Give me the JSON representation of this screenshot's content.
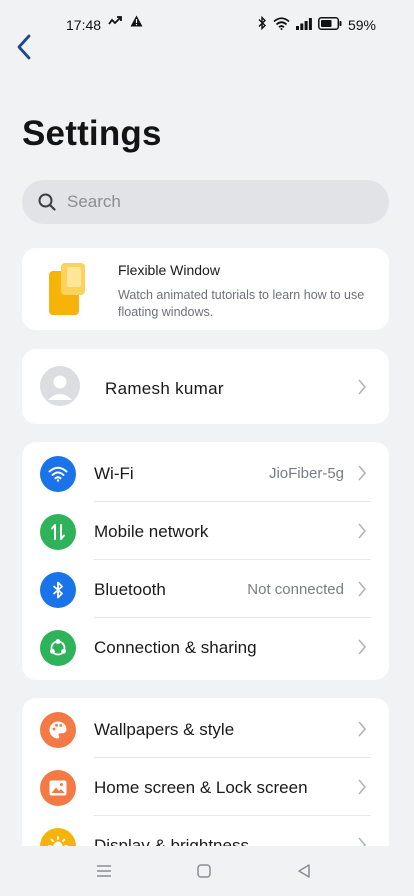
{
  "status_bar": {
    "time": "17:48",
    "battery_percent": "59%",
    "icons_left": [
      "call-forward-icon",
      "warning-icon"
    ],
    "icons_right": [
      "bluetooth-icon",
      "wifi-icon",
      "signal-icon",
      "battery-icon"
    ]
  },
  "header": {
    "title": "Settings"
  },
  "search": {
    "placeholder": "Search"
  },
  "flexible_window": {
    "title": "Flexible Window",
    "description": "Watch animated tutorials to learn how to use floating windows."
  },
  "profile": {
    "name": "Ramesh kumar"
  },
  "connectivity": [
    {
      "label": "Wi-Fi",
      "value": "JioFiber-5g",
      "icon": "wifi-icon",
      "color": "#1a73e8"
    },
    {
      "label": "Mobile network",
      "value": "",
      "icon": "mobile-data-icon",
      "color": "#2fb35a"
    },
    {
      "label": "Bluetooth",
      "value": "Not connected",
      "icon": "bluetooth-icon",
      "color": "#1a73e8"
    },
    {
      "label": "Connection & sharing",
      "value": "",
      "icon": "share-icon",
      "color": "#2fb35a"
    }
  ],
  "personalization": [
    {
      "label": "Wallpapers & style",
      "icon": "palette-icon",
      "color": "#f47a45"
    },
    {
      "label": "Home screen & Lock screen",
      "icon": "image-icon",
      "color": "#f47a45"
    },
    {
      "label": "Display & brightness",
      "icon": "sun-icon",
      "color": "#f6b40a"
    }
  ],
  "nav_bar": {
    "buttons": [
      "menu-icon",
      "home-icon",
      "back-icon"
    ]
  }
}
